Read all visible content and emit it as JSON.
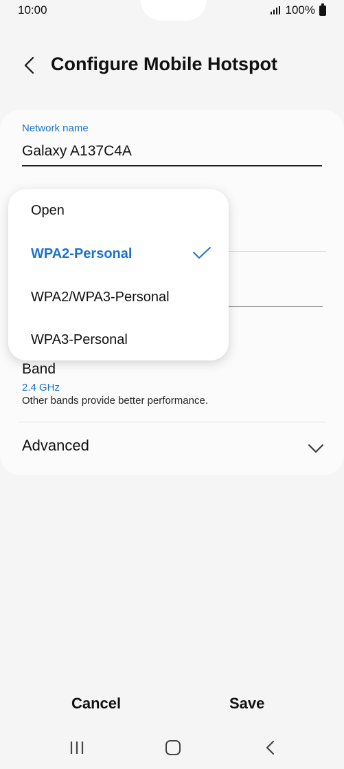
{
  "status_bar": {
    "time": "10:00",
    "battery": "100%"
  },
  "header": {
    "title": "Configure Mobile Hotspot",
    "back_icon": "chevron-left-icon"
  },
  "network": {
    "label": "Network name",
    "value": "Galaxy A137C4A"
  },
  "security_dropdown": {
    "options": [
      "Open",
      "WPA2-Personal",
      "WPA2/WPA3-Personal",
      "WPA3-Personal"
    ],
    "selected": "WPA2-Personal",
    "selected_icon": "checkmark-icon"
  },
  "band": {
    "label": "Band",
    "value": "2.4 GHz",
    "description": "Other bands provide better performance."
  },
  "advanced": {
    "label": "Advanced",
    "icon": "chevron-down-icon"
  },
  "footer": {
    "cancel_label": "Cancel",
    "save_label": "Save"
  },
  "colors": {
    "accent": "#1a73c9",
    "background": "#f5f5f5",
    "card": "#fbfbfb"
  },
  "nav_icons": [
    "recent-apps-icon",
    "home-icon",
    "back-icon"
  ]
}
